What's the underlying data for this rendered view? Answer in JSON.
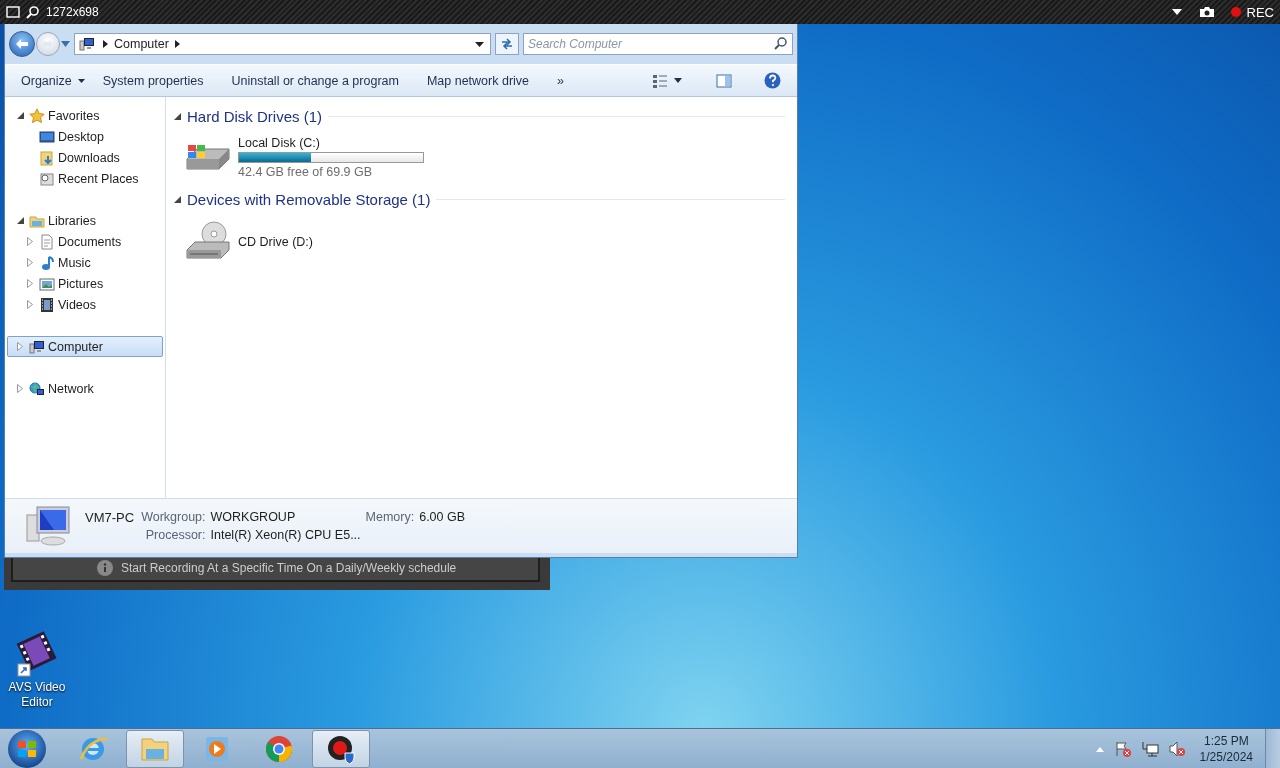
{
  "recorder_bar": {
    "resolution": "1272x698",
    "status": "REC"
  },
  "explorer": {
    "address": {
      "crumbs": [
        "Computer"
      ]
    },
    "search": {
      "placeholder": "Search Computer"
    },
    "toolbar": [
      {
        "label": "Organize",
        "kind": "menu"
      },
      {
        "label": "System properties",
        "kind": "button"
      },
      {
        "label": "Uninstall or change a program",
        "kind": "button"
      },
      {
        "label": "Map network drive",
        "kind": "button"
      },
      {
        "label": "»",
        "kind": "more"
      }
    ],
    "nav": [
      {
        "label": "Favorites",
        "kind": "star",
        "expanded": true,
        "selected": false,
        "children": [
          {
            "label": "Desktop",
            "kind": "desktop",
            "selected": false
          },
          {
            "label": "Downloads",
            "kind": "downloads",
            "selected": false
          },
          {
            "label": "Recent Places",
            "kind": "recent",
            "selected": false
          }
        ]
      },
      {
        "label": "Libraries",
        "kind": "libraries",
        "expanded": true,
        "selected": false,
        "children": [
          {
            "label": "Documents",
            "kind": "documents",
            "expanded": false,
            "selected": false
          },
          {
            "label": "Music",
            "kind": "music",
            "expanded": false,
            "selected": false
          },
          {
            "label": "Pictures",
            "kind": "pictures",
            "expanded": false,
            "selected": false
          },
          {
            "label": "Videos",
            "kind": "videos",
            "expanded": false,
            "selected": false
          }
        ]
      },
      {
        "label": "Computer",
        "kind": "computer",
        "expanded": false,
        "selected": true
      },
      {
        "label": "Network",
        "kind": "network",
        "expanded": false,
        "selected": false
      }
    ],
    "groups": [
      {
        "title": "Hard Disk Drives (1)",
        "expanded": true,
        "items": [
          {
            "name": "Local Disk (C:)",
            "kind": "disk",
            "level": 0.39,
            "free": "42.4 GB free of 69.9 GB"
          }
        ]
      },
      {
        "title": "Devices with Removable Storage (1)",
        "expanded": true,
        "items": [
          {
            "name": "CD Drive (D:)",
            "kind": "cd"
          }
        ]
      }
    ],
    "details": {
      "name": "VM7-PC",
      "fields": [
        {
          "label": "Workgroup:",
          "value": "WORKGROUP"
        },
        {
          "label": "Memory:",
          "value": "6.00 GB"
        },
        {
          "label": "Processor:",
          "value": "Intel(R) Xeon(R) CPU E5..."
        }
      ]
    }
  },
  "background_window": {
    "tip": "Start Recording At a Specific Time On a Daily/Weekly schedule"
  },
  "desktop_icons": [
    {
      "label": "AVS Video Editor",
      "kind": "video"
    }
  ],
  "taskbar": {
    "apps": [
      {
        "kind": "ie",
        "running": false
      },
      {
        "kind": "explorer",
        "running": true
      },
      {
        "kind": "media",
        "running": false
      },
      {
        "kind": "chrome",
        "running": false
      },
      {
        "kind": "recorder",
        "running": true
      }
    ],
    "tray": [
      {
        "kind": "flag"
      },
      {
        "kind": "network"
      },
      {
        "kind": "speaker"
      }
    ],
    "time": "1:25 PM",
    "date": "1/25/2024"
  }
}
